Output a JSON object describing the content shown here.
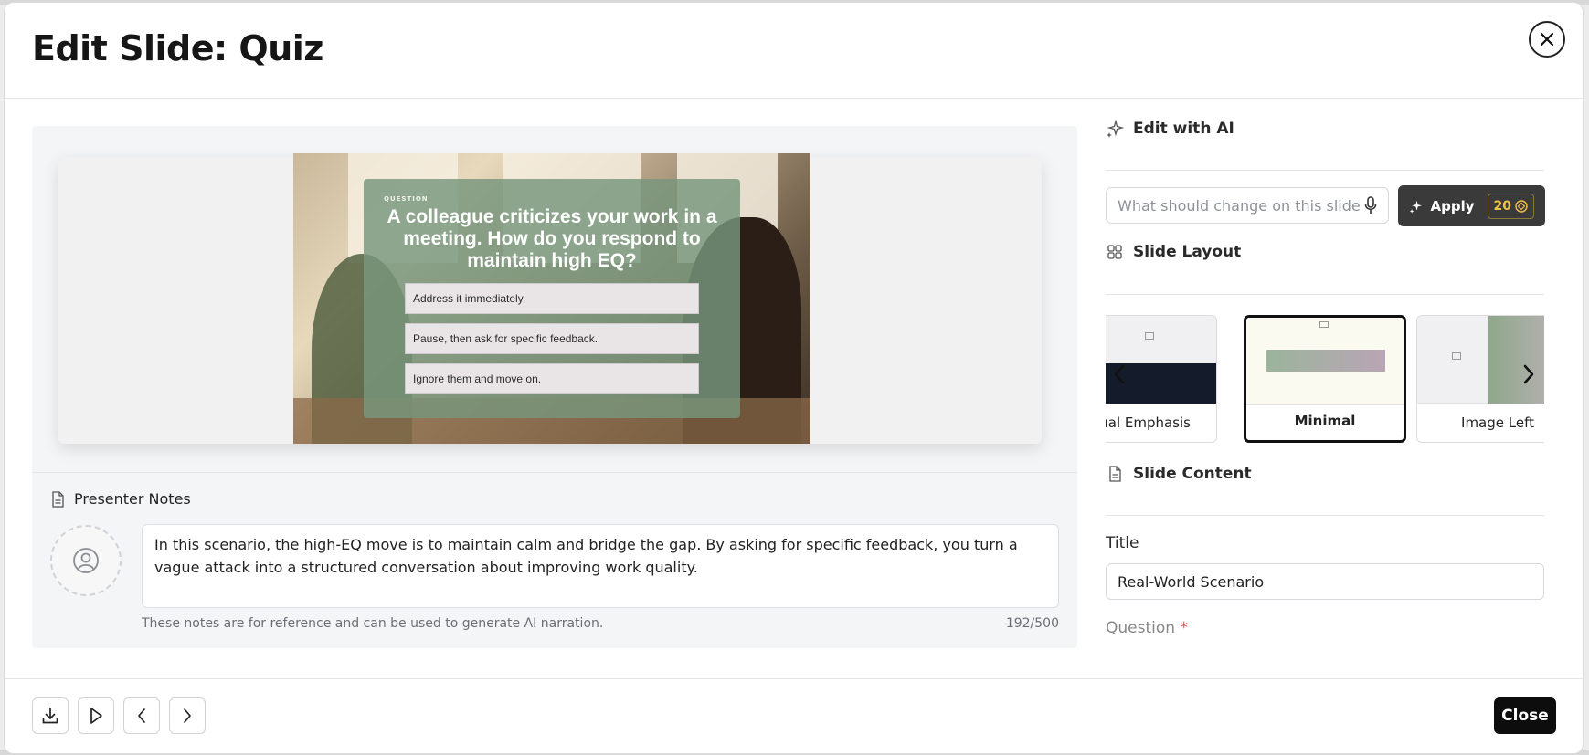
{
  "modal": {
    "title": "Edit Slide: Quiz",
    "close_icon": "close-icon"
  },
  "slide_preview": {
    "kicker": "QUESTION",
    "question": "A colleague criticizes your work in a meeting. How do you respond to maintain high EQ?",
    "options": [
      "Address it immediately.",
      "Pause, then ask for specific feedback.",
      "Ignore them and move on."
    ]
  },
  "notes": {
    "heading": "Presenter Notes",
    "text": "In this scenario, the high-EQ move is to maintain calm and bridge the gap. By asking for specific feedback, you turn a vague attack into a structured conversation about improving work quality.",
    "hint": "These notes are for reference and can be used to generate AI narration.",
    "count": "192/500"
  },
  "ai": {
    "heading": "Edit with AI",
    "placeholder": "What should change on this slide",
    "apply_label": "Apply",
    "credits": "20"
  },
  "layout": {
    "heading": "Slide Layout",
    "cards": [
      {
        "label": "Dual Emphasis",
        "selected": false
      },
      {
        "label": "Minimal",
        "selected": true
      },
      {
        "label": "Image Left",
        "selected": false
      }
    ]
  },
  "content": {
    "heading": "Slide Content",
    "title_label": "Title",
    "title_value": "Real-World Scenario",
    "question_label": "Question",
    "required_mark": "*"
  },
  "footer": {
    "close_label": "Close"
  },
  "colors": {
    "apply_bg": "#3a3a3a",
    "credit": "#f0c443",
    "required": "#e5484d"
  }
}
